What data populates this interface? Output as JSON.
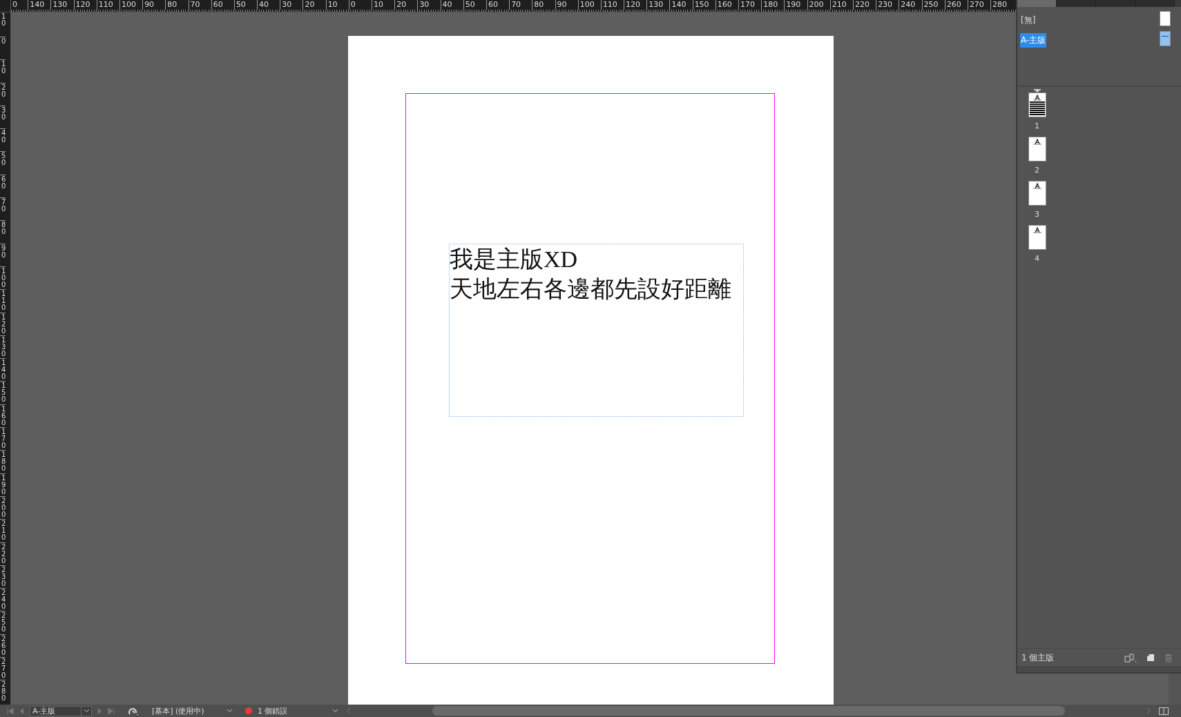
{
  "rulers": {
    "horizontal": [
      "0",
      "140",
      "130",
      "120",
      "110",
      "100",
      "90",
      "80",
      "70",
      "60",
      "50",
      "40",
      "30",
      "20",
      "10",
      "0",
      "10",
      "20",
      "30",
      "40",
      "50",
      "60",
      "70",
      "80",
      "90",
      "100",
      "110",
      "120",
      "130",
      "140",
      "150",
      "160",
      "170",
      "180",
      "190",
      "200",
      "210",
      "220",
      "230",
      "240",
      "250",
      "260",
      "270",
      "280"
    ],
    "vertical": [
      "10",
      "0",
      "10",
      "20",
      "30",
      "40",
      "50",
      "60",
      "70",
      "80",
      "90",
      "100",
      "110",
      "120",
      "130",
      "140",
      "150",
      "160",
      "170",
      "180",
      "190",
      "200",
      "210",
      "220",
      "230",
      "240",
      "250",
      "260",
      "270",
      "280"
    ]
  },
  "document": {
    "text_lines": [
      "我是主版XD",
      "天地左右各邊都先設好距離"
    ]
  },
  "pages_panel": {
    "tabs": [
      {
        "selected": true
      },
      {
        "selected": false
      },
      {
        "selected": false
      },
      {
        "selected": false
      }
    ],
    "masters": [
      {
        "label": "[無]",
        "selected": false,
        "kind": "none"
      },
      {
        "label": "A-主版",
        "selected": true,
        "kind": "master"
      }
    ],
    "pages": [
      {
        "number": "1",
        "kind": "text"
      },
      {
        "number": "2",
        "kind": "blank"
      },
      {
        "number": "3",
        "kind": "blank"
      },
      {
        "number": "4",
        "kind": "blank"
      }
    ],
    "footer": "1 個主版"
  },
  "status_bar": {
    "page_field": "A-主版",
    "profile": "[基本] (使用中)",
    "errors": "1 個錯誤"
  }
}
